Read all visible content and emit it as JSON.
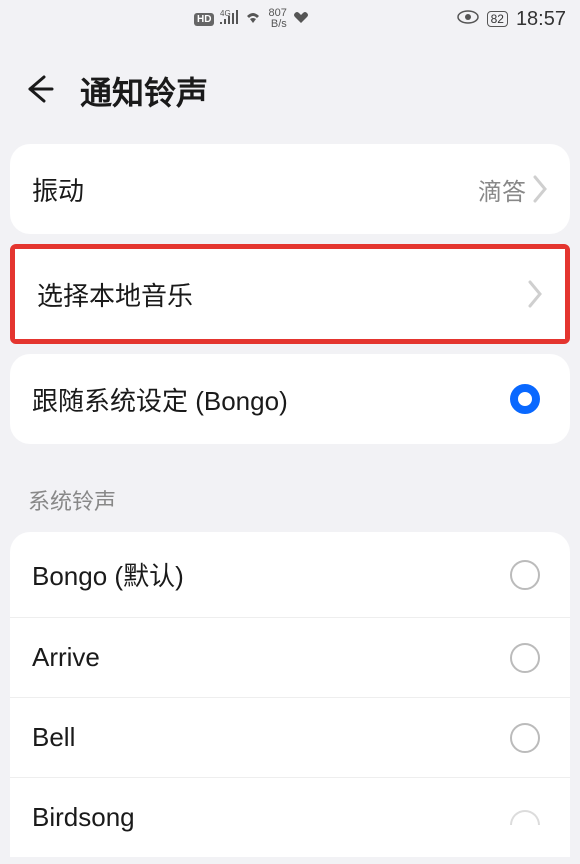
{
  "status_bar": {
    "hd": "HD",
    "network_gen": "4G",
    "speed_value": "807",
    "speed_unit": "B/s",
    "battery": "82",
    "time": "18:57"
  },
  "header": {
    "title": "通知铃声"
  },
  "vibration": {
    "label": "振动",
    "value": "滴答"
  },
  "local_music": {
    "label": "选择本地音乐"
  },
  "follow_system": {
    "label": "跟随系统设定 (Bongo)"
  },
  "section": {
    "label": "系统铃声"
  },
  "ringtones": [
    {
      "label": "Bongo (默认)",
      "selected": false
    },
    {
      "label": "Arrive",
      "selected": false
    },
    {
      "label": "Bell",
      "selected": false
    },
    {
      "label": "Birdsong",
      "selected": false
    }
  ]
}
